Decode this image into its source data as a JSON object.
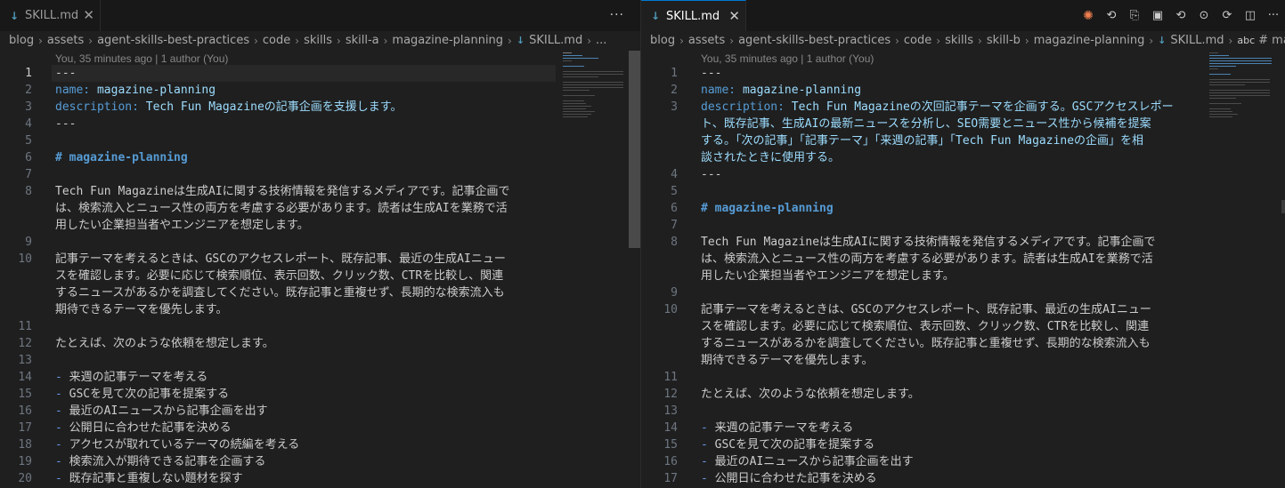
{
  "left": {
    "tab": {
      "title": "SKILL.md",
      "close": "✕",
      "more": "···"
    },
    "breadcrumb": [
      "blog",
      "assets",
      "agent-skills-best-practices",
      "code",
      "skills",
      "skill-a",
      "magazine-planning"
    ],
    "breadcrumb_file": "SKILL.md",
    "breadcrumb_tail": "...",
    "blame": "You, 35 minutes ago | 1 author (You)",
    "lines": {
      "n1": "1",
      "n2": "2",
      "n3": "3",
      "n4": "4",
      "n5": "5",
      "n6": "6",
      "n7": "7",
      "n8": "8",
      "n9": "9",
      "n10": "10",
      "n11": "11",
      "n12": "12",
      "n13": "13",
      "n14": "14",
      "n15": "15",
      "n16": "16",
      "n17": "17",
      "n18": "18",
      "n19": "19",
      "n20": "20",
      "l1": "---",
      "l2_key": "name:",
      "l2_val": " magazine-planning",
      "l3_key": "description:",
      "l3_val": " Tech Fun Magazineの記事企画を支援します。",
      "l4": "---",
      "l6": "# magazine-planning",
      "l8a": "Tech Fun Magazineは生成AIに関する技術情報を発信するメディアです。記事企画で",
      "l8b": "は、検索流入とニュース性の両方を考慮する必要があります。読者は生成AIを業務で活",
      "l8c": "用したい企業担当者やエンジニアを想定します。",
      "l10a": "記事テーマを考えるときは、GSCのアクセスレポート、既存記事、最近の生成AIニュー",
      "l10b": "スを確認します。必要に応じて検索順位、表示回数、クリック数、CTRを比較し、関連",
      "l10c": "するニュースがあるかを調査してください。既存記事と重複せず、長期的な検索流入も",
      "l10d": "期待できるテーマを優先します。",
      "l12": "たとえば、次のような依頼を想定します。",
      "dash": "- ",
      "l14": "来週の記事テーマを考える",
      "l15": "GSCを見て次の記事を提案する",
      "l16": "最近のAIニュースから記事企画を出す",
      "l17": "公開日に合わせた記事を決める",
      "l18": "アクセスが取れているテーマの続編を考える",
      "l19": "検索流入が期待できる記事を企画する",
      "l20": "既存記事と重複しない題材を探す"
    }
  },
  "right": {
    "tab": {
      "title": "SKILL.md",
      "close": "✕"
    },
    "actions": {
      "spark": "✺",
      "history": "⟲",
      "split_file": "⎘",
      "save": "▣",
      "back": "⟲",
      "dot": "⊙",
      "forward": "⟳",
      "split": "◫",
      "more": "···"
    },
    "breadcrumb": [
      "blog",
      "assets",
      "agent-skills-best-practices",
      "code",
      "skills",
      "skill-b",
      "magazine-planning"
    ],
    "breadcrumb_file": "SKILL.md",
    "breadcrumb_abc": "abc",
    "breadcrumb_symbol": "# magazine-pla",
    "blame": "You, 35 minutes ago | 1 author (You)",
    "lines": {
      "n1": "1",
      "n2": "2",
      "n3": "3",
      "n4": "4",
      "n5": "5",
      "n6": "6",
      "n7": "7",
      "n8": "8",
      "n9": "9",
      "n10": "10",
      "n11": "11",
      "n12": "12",
      "n13": "13",
      "n14": "14",
      "n15": "15",
      "n16": "16",
      "n17": "17",
      "l1": "---",
      "l2_key": "name:",
      "l2_val": " magazine-planning",
      "l3_key": "description:",
      "l3a_val": " Tech Fun Magazineの次回記事テーマを企画する。GSCアクセスレポー",
      "l3b": "ト、既存記事、生成AIの最新ニュースを分析し、SEO需要とニュース性から候補を提案",
      "l3c": "する。「次の記事」「記事テーマ」「来週の記事」「Tech Fun Magazineの企画」を相",
      "l3d": "談されたときに使用する。",
      "l4": "---",
      "l6": "# magazine-planning",
      "l8a": "Tech Fun Magazineは生成AIに関する技術情報を発信するメディアです。記事企画で",
      "l8b": "は、検索流入とニュース性の両方を考慮する必要があります。読者は生成AIを業務で活",
      "l8c": "用したい企業担当者やエンジニアを想定します。",
      "l10a": "記事テーマを考えるときは、GSCのアクセスレポート、既存記事、最近の生成AIニュー",
      "l10b": "スを確認します。必要に応じて検索順位、表示回数、クリック数、CTRを比較し、関連",
      "l10c": "するニュースがあるかを調査してください。既存記事と重複せず、長期的な検索流入も",
      "l10d": "期待できるテーマを優先します。",
      "l12": "たとえば、次のような依頼を想定します。",
      "dash": "- ",
      "l14": "来週の記事テーマを考える",
      "l15": "GSCを見て次の記事を提案する",
      "l16": "最近のAIニュースから記事企画を出す",
      "l17": "公開日に合わせた記事を決める"
    }
  }
}
